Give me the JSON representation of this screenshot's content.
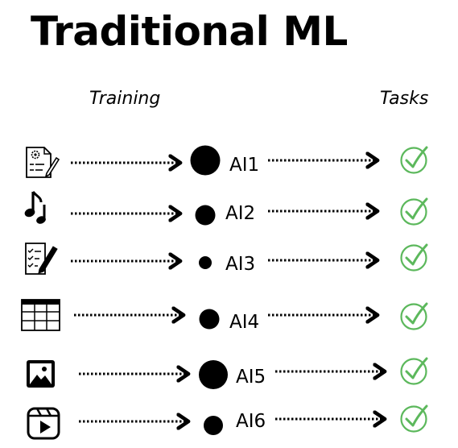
{
  "title": "Traditional ML",
  "headers": {
    "training": "Training",
    "tasks": "Tasks"
  },
  "colors": {
    "text": "#000000",
    "check": "#5cb85c"
  },
  "rows": [
    {
      "icon": "settings-document-icon",
      "label": "AI1",
      "node_size": "large"
    },
    {
      "icon": "music-note-icon",
      "label": "AI2",
      "node_size": "medium"
    },
    {
      "icon": "checklist-pencil-icon",
      "label": "AI3",
      "node_size": "small"
    },
    {
      "icon": "table-grid-icon",
      "label": "AI4",
      "node_size": "medium"
    },
    {
      "icon": "image-icon",
      "label": "AI5",
      "node_size": "large"
    },
    {
      "icon": "video-play-icon",
      "label": "AI6",
      "node_size": "medium"
    }
  ]
}
